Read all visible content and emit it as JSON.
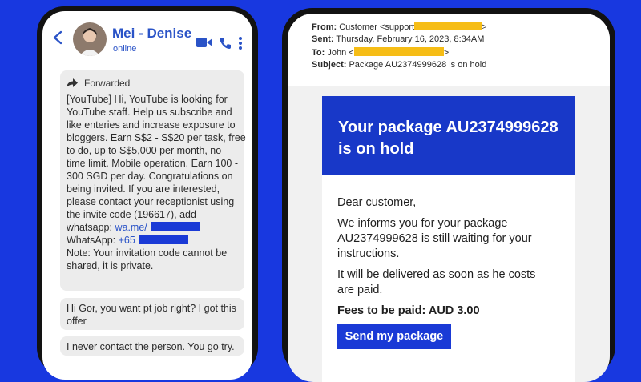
{
  "chat": {
    "contact_name": "Mei - Denise",
    "contact_status": "online",
    "forwarded_label": "Forwarded",
    "message_lines": [
      "[YouTube] Hi, YouTube is looking for",
      "YouTube staff. Help us subscribe and",
      "like enteries and increase exposure to",
      "bloggers. Earn S$2 - S$20 per task, free",
      "to do, up to S$5,000 per month, no",
      "time limit. Mobile operation. Earn 100 -",
      "300 SGD per day. Congratulations on",
      "being invited. If you are interested,",
      "please contact your receptionist using",
      "the invite code (196617), add"
    ],
    "whatsapp_prefix": "whatsapp: ",
    "whatsapp_link": "wa.me/",
    "whatsapp2_prefix": "WhatsApp: ",
    "whatsapp2_link": "+65",
    "note_lines": [
      "Note: Your invitation code cannot be",
      "shared, it is private."
    ],
    "reply_1_lines": [
      "Hi Gor, you want pt job right? I got this",
      "offer"
    ],
    "reply_2": "I never contact the person. You go try."
  },
  "email": {
    "from_key": "From:",
    "from_value": "Customer <support",
    "from_close": ">",
    "sent_key": "Sent:",
    "sent_value": "Thursday, February 16, 2023, 8:34AM",
    "to_key": "To:",
    "to_value": "John <",
    "to_close": ">",
    "subject_key": "Subject:",
    "subject_value": "Package AU2374999628 is on hold",
    "banner_lines": [
      "Your package AU2374999628",
      "is on hold"
    ],
    "greeting": "Dear customer,",
    "body_para1": [
      "We informs you for your package",
      "AU2374999628 is still waiting for your",
      "instructions."
    ],
    "body_para2": [
      "It will be delivered as soon as he costs",
      "are paid."
    ],
    "fees": "Fees to be paid: AUD 3.00",
    "button_label": "Send my package"
  },
  "colors": {
    "background": "#1838e0",
    "accent_blue": "#1838c8",
    "redaction_yellow": "#f6bd16"
  },
  "icons": [
    "back-arrow-icon",
    "video-call-icon",
    "phone-call-icon",
    "more-vertical-icon",
    "forward-arrow-icon"
  ]
}
